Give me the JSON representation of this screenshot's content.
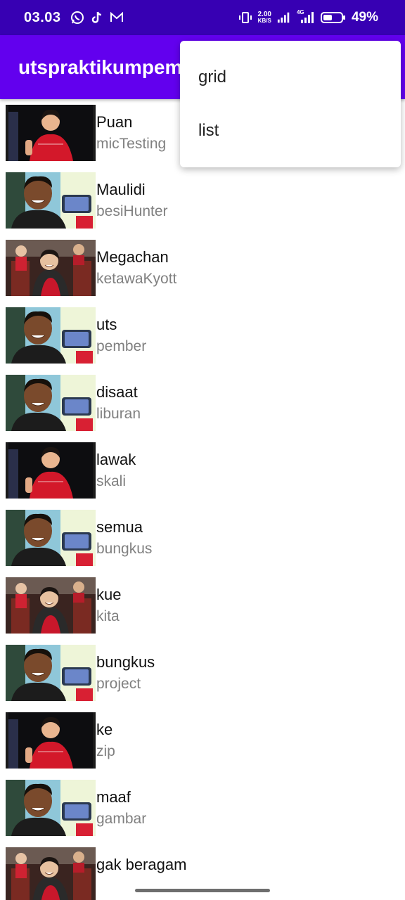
{
  "status_bar": {
    "time": "03.03",
    "left_icons": [
      "whatsapp-icon",
      "tiktok-icon",
      "gmail-icon"
    ],
    "speed_value": "2.00",
    "speed_unit": "KB/S",
    "network_label": "4G",
    "battery_percent": "49%",
    "battery_level": 0.49
  },
  "app_bar": {
    "title": "utspraktikumpemrograman"
  },
  "menu": {
    "items": [
      {
        "label": "grid"
      },
      {
        "label": "list"
      }
    ]
  },
  "list": {
    "items": [
      {
        "title": "Puan",
        "subtitle": "micTesting",
        "photo": "woman-red-dress-waving"
      },
      {
        "title": "Maulidi",
        "subtitle": "besiHunter",
        "photo": "young-man-holding-phone"
      },
      {
        "title": "Megachan",
        "subtitle": "ketawaKyott",
        "photo": "woman-laughing-seated-group"
      },
      {
        "title": "uts",
        "subtitle": "pember",
        "photo": "young-man-holding-phone"
      },
      {
        "title": "disaat",
        "subtitle": "liburan",
        "photo": "young-man-holding-phone"
      },
      {
        "title": "lawak",
        "subtitle": "skali",
        "photo": "woman-red-dress-waving"
      },
      {
        "title": "semua",
        "subtitle": "bungkus",
        "photo": "young-man-holding-phone"
      },
      {
        "title": "kue",
        "subtitle": "kita",
        "photo": "woman-laughing-seated-group"
      },
      {
        "title": "bungkus",
        "subtitle": "project",
        "photo": "young-man-holding-phone"
      },
      {
        "title": "ke",
        "subtitle": "zip",
        "photo": "woman-red-dress-waving"
      },
      {
        "title": "maaf",
        "subtitle": "gambar",
        "photo": "young-man-holding-phone"
      },
      {
        "title": "gak beragam",
        "subtitle": "",
        "photo": "woman-laughing-seated-group"
      }
    ]
  },
  "colors": {
    "status_bar": "#3700b3",
    "app_bar": "#6200ee",
    "title_text": "#111111",
    "subtitle_text": "#808080"
  }
}
